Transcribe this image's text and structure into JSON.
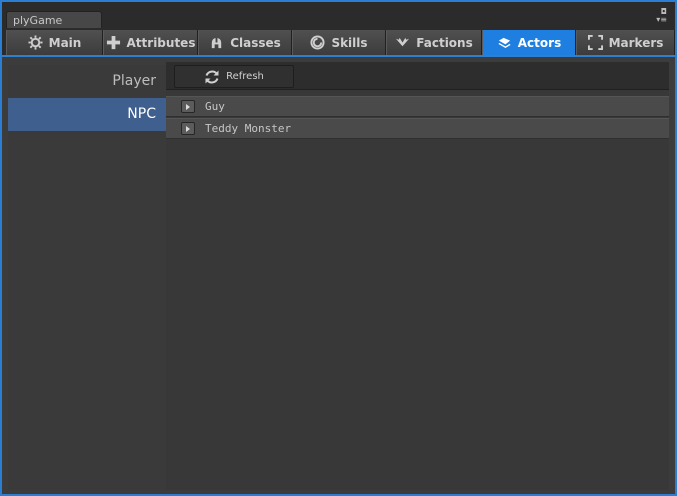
{
  "window": {
    "title": "plyGame"
  },
  "tabs": [
    {
      "label": "Main",
      "icon": "gear-icon"
    },
    {
      "label": "Attributes",
      "icon": "plus-icon"
    },
    {
      "label": "Classes",
      "icon": "helmet-icon"
    },
    {
      "label": "Skills",
      "icon": "swirl-icon"
    },
    {
      "label": "Factions",
      "icon": "wings-icon"
    },
    {
      "label": "Actors",
      "icon": "actors-icon",
      "active": true
    },
    {
      "label": "Markers",
      "icon": "markers-icon"
    }
  ],
  "sidebar": {
    "items": [
      {
        "label": "Player"
      },
      {
        "label": "NPC",
        "active": true
      }
    ]
  },
  "toolbar": {
    "refresh_label": "Refresh"
  },
  "list": {
    "items": [
      {
        "label": "Guy"
      },
      {
        "label": "Teddy Monster"
      }
    ]
  },
  "colors": {
    "accent": "#1e7fe0",
    "sidebar_selected": "#3f5f8f",
    "window_border": "#2a7fd4"
  }
}
